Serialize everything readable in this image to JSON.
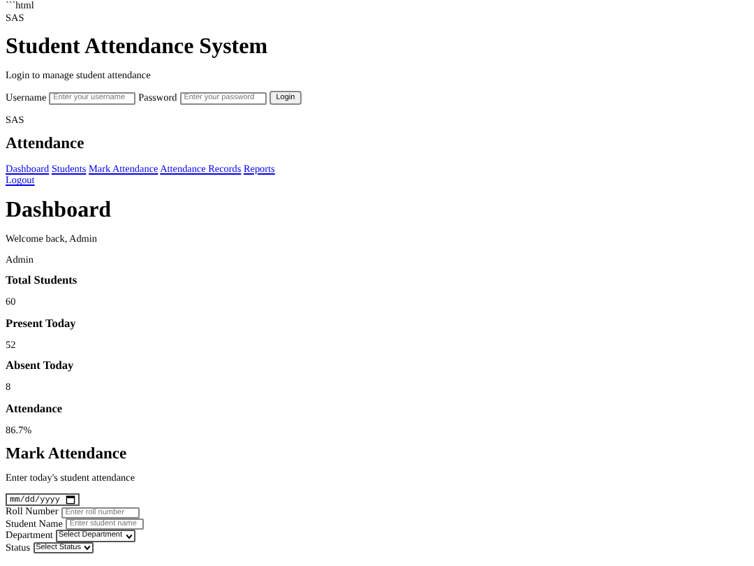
{
  "code_fence": "```html",
  "login_section": {
    "logo": "SAS",
    "title": "Student Attendance System",
    "subtitle": "Login to manage student attendance",
    "fields": [
      {
        "label": "Username",
        "placeholder": "Enter your username"
      },
      {
        "label": "Password",
        "placeholder": "Enter your password"
      }
    ],
    "button": "Login"
  },
  "sidebar": {
    "logo": "SAS",
    "title": "Attendance",
    "nav": [
      {
        "label": "Dashboard"
      },
      {
        "label": "Students"
      },
      {
        "label": "Mark Attendance"
      },
      {
        "label": "Attendance Records"
      },
      {
        "label": "Reports"
      }
    ],
    "logout": "Logout"
  },
  "dashboard": {
    "title": "Dashboard",
    "welcome": "Welcome back, Admin",
    "user": "Admin",
    "stats": [
      {
        "label": "Total Students",
        "value": "60"
      },
      {
        "label": "Present Today",
        "value": "52"
      },
      {
        "label": "Absent Today",
        "value": "8"
      },
      {
        "label": "Attendance",
        "value": "86.7%"
      }
    ]
  },
  "mark_attendance": {
    "title": "Mark Attendance",
    "subtitle": "Enter today's student attendance",
    "date_field": {
      "placeholder": "mm/dd/yyyy"
    },
    "fields": [
      {
        "kind": "input",
        "label": "Roll Number",
        "placeholder": "Enter roll number"
      },
      {
        "kind": "input",
        "label": "Student Name",
        "placeholder": "Enter student name"
      },
      {
        "kind": "select",
        "label": "Department",
        "value": "Select Department"
      },
      {
        "kind": "select",
        "label": "Status",
        "value": "Select Status"
      }
    ]
  }
}
